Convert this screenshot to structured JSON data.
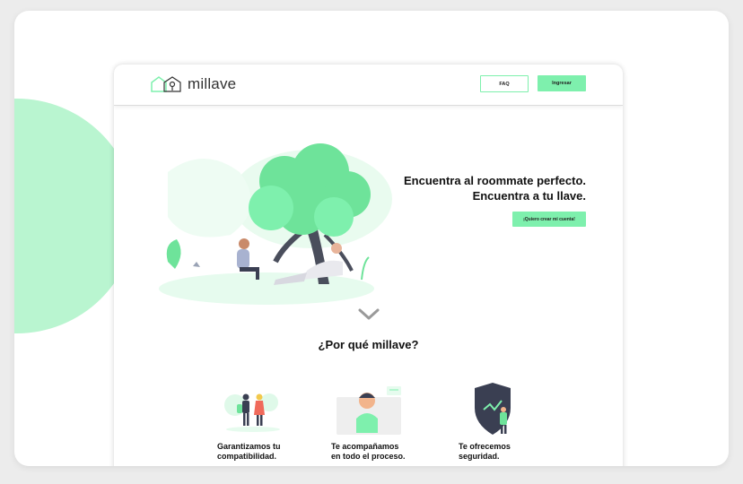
{
  "brand": {
    "name": "millave",
    "accent": "#7ef0ad",
    "accent_light": "#b9f5d0"
  },
  "header": {
    "faq_label": "FAQ",
    "login_label": "Ingresar"
  },
  "hero": {
    "headline_1": "Encuentra al roommate perfecto.",
    "headline_2": "Encuentra a tu llave.",
    "cta_label": "¡Quiero crear mi cuenta!"
  },
  "why": {
    "title": "¿Por qué millave?",
    "features": [
      {
        "line1": "Garantizamos tu",
        "line2": "compatibilidad.",
        "icon": "people-handshake-icon"
      },
      {
        "line1": "Te acompañamos",
        "line2": "en todo el proceso.",
        "icon": "support-person-icon"
      },
      {
        "line1": "Te ofrecemos",
        "line2": "seguridad.",
        "icon": "shield-icon"
      }
    ]
  }
}
